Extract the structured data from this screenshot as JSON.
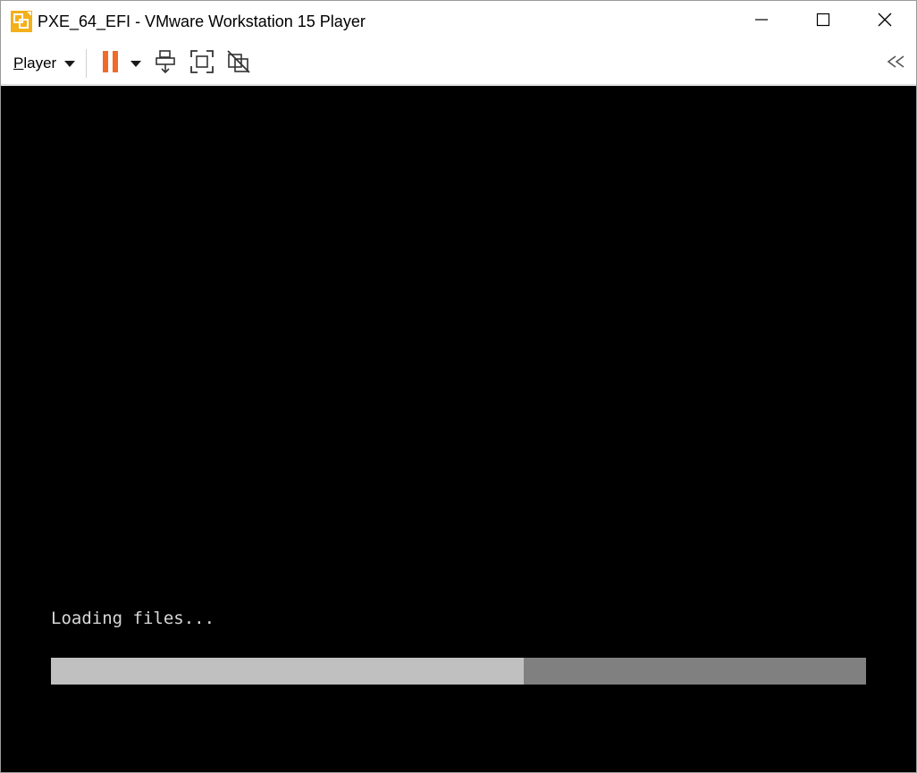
{
  "window": {
    "title": "PXE_64_EFI - VMware Workstation 15 Player",
    "app_icon": "vmware-player-icon",
    "controls": {
      "minimize_icon": "minimize-icon",
      "maximize_icon": "maximize-icon",
      "close_icon": "close-icon"
    }
  },
  "toolbar": {
    "player_menu_label": "Player",
    "buttons": [
      {
        "name": "pause",
        "icon": "pause-icon",
        "color": "#f06a2a"
      },
      {
        "name": "power-options",
        "icon": "chevron-down-icon"
      },
      {
        "name": "send-ctrl-alt-del",
        "icon": "ctrl-alt-del-icon"
      },
      {
        "name": "full-screen",
        "icon": "fullscreen-icon"
      },
      {
        "name": "unity",
        "icon": "unity-disabled-icon"
      }
    ],
    "collapse_icon": "double-chevron-left-icon"
  },
  "vm": {
    "status_text": "Loading files...",
    "progress_fraction": 0.58,
    "colors": {
      "background": "#000000",
      "text": "#d8d8d8",
      "progress_fill": "#c0c0c0",
      "progress_track": "#808080"
    }
  }
}
